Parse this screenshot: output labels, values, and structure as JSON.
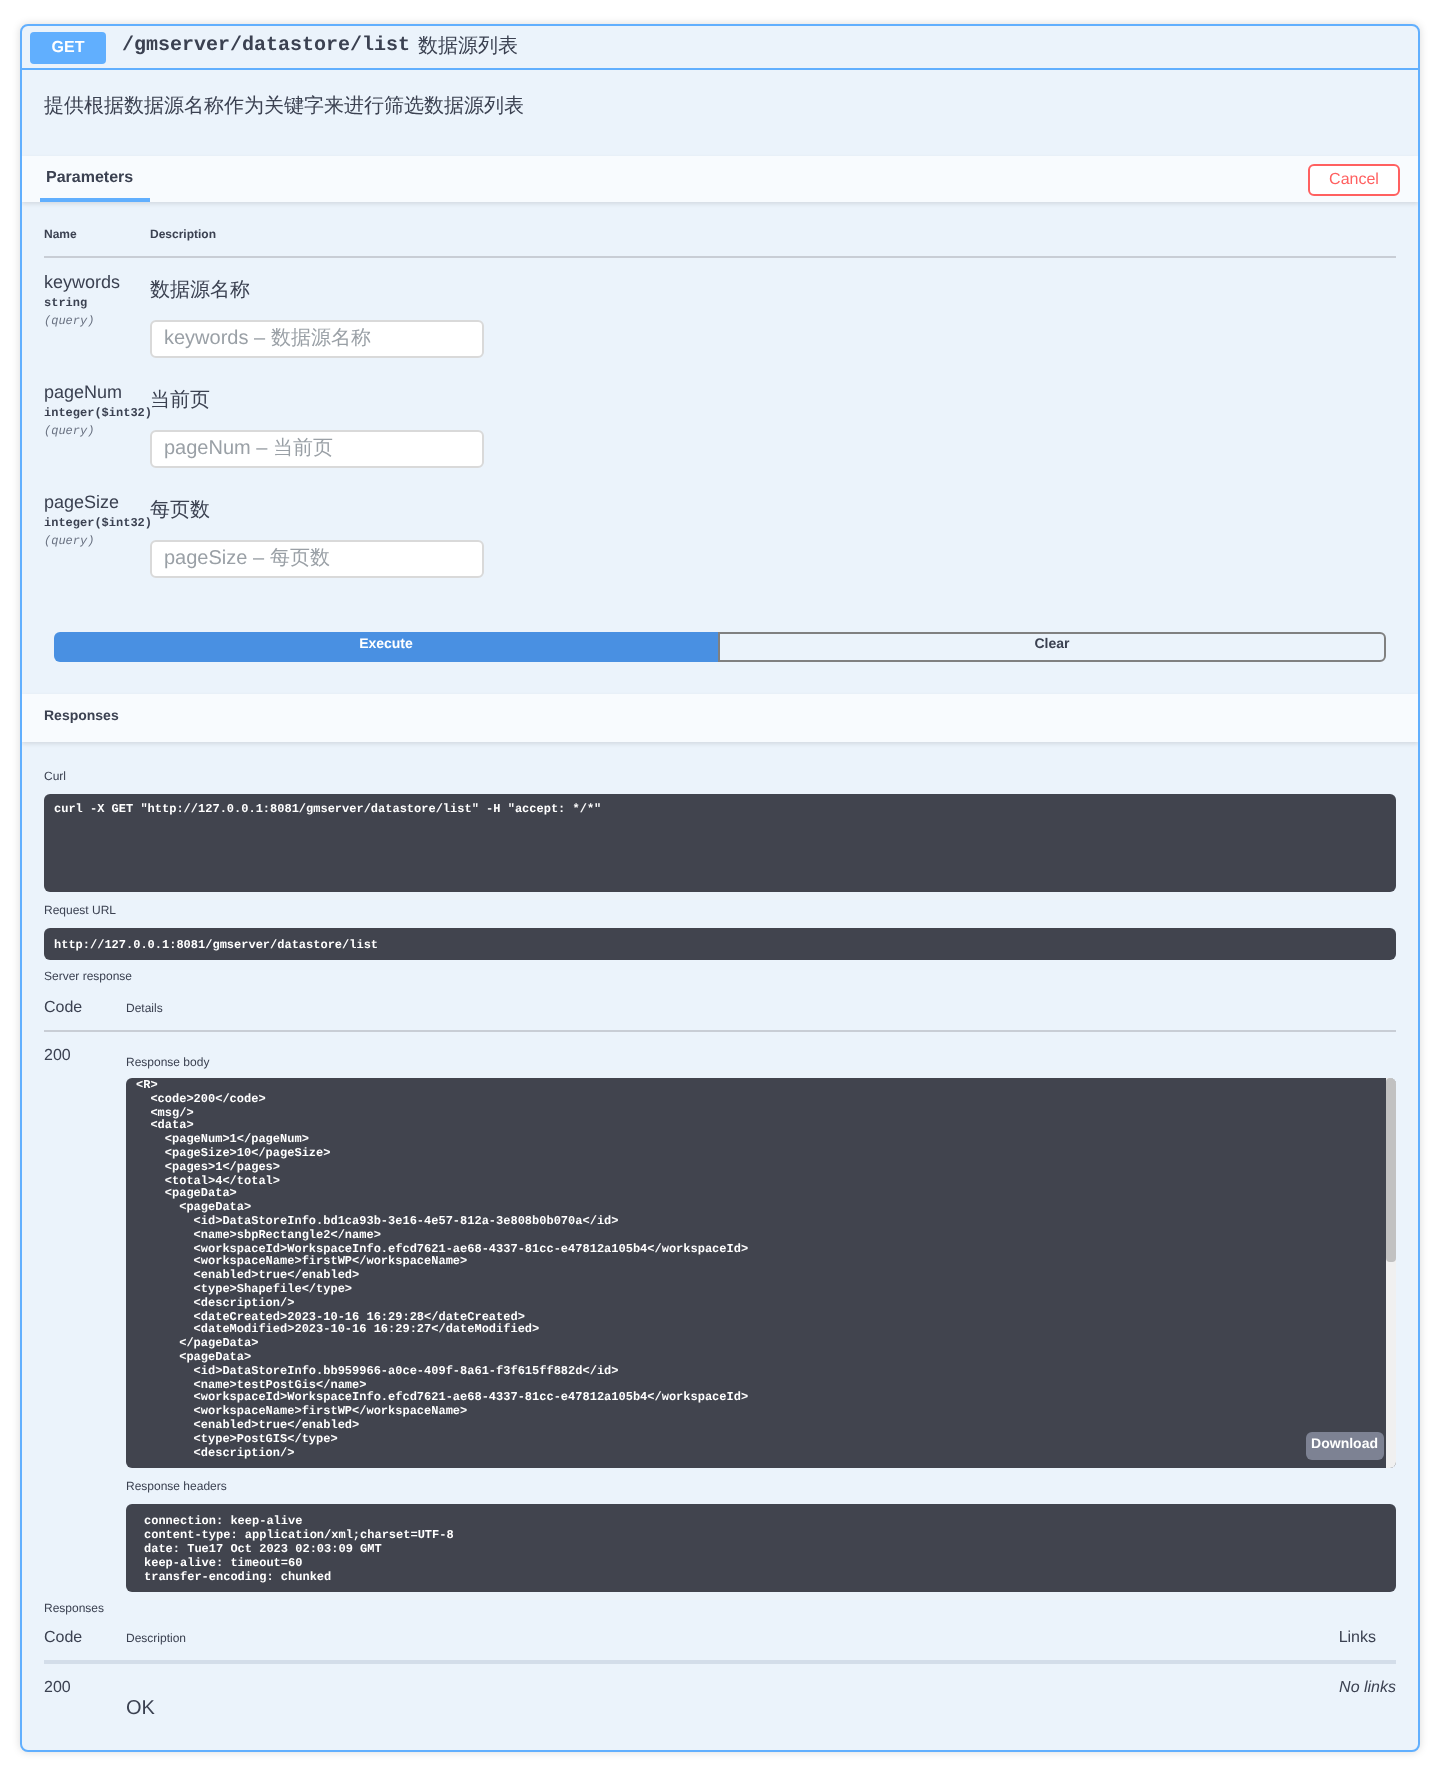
{
  "operation": {
    "method": "GET",
    "path": "/gmserver/datastore/list",
    "summary": "数据源列表",
    "description": "提供根据数据源名称作为关键字来进行筛选数据源列表"
  },
  "parameters_section": {
    "tabs": [
      {
        "label": "Parameters",
        "selected": true
      }
    ],
    "cancel_button": "Cancel",
    "columns": [
      "Name",
      "Description"
    ]
  },
  "parameters": [
    {
      "name": "keywords",
      "type": "string",
      "location": "(query)",
      "description": "数据源名称",
      "placeholder": "keywords – 数据源名称"
    },
    {
      "name": "pageNum",
      "type": "integer($int32)",
      "location": "(query)",
      "description": "当前页",
      "placeholder": "pageNum – 当前页"
    },
    {
      "name": "pageSize",
      "type": "integer($int32)",
      "location": "(query)",
      "description": "每页数",
      "placeholder": "pageSize – 每页数"
    }
  ],
  "execute_button": "Execute",
  "clear_button": "Clear",
  "responses_heading": "Responses",
  "curl": {
    "label": "Curl",
    "command": "curl -X GET \"http://127.0.0.1:8081/gmserver/datastore/list\" -H \"accept: */*\""
  },
  "request_url": {
    "label": "Request URL",
    "value": "http://127.0.0.1:8081/gmserver/datastore/list"
  },
  "server_response": {
    "label": "Server response",
    "columns": [
      "Code",
      "Details"
    ],
    "code": "200",
    "body_label": "Response body",
    "body": "<R>\n  <code>200</code>\n  <msg/>\n  <data>\n    <pageNum>1</pageNum>\n    <pageSize>10</pageSize>\n    <pages>1</pages>\n    <total>4</total>\n    <pageData>\n      <pageData>\n        <id>DataStoreInfo.bd1ca93b-3e16-4e57-812a-3e808b0b070a</id>\n        <name>sbpRectangle2</name>\n        <workspaceId>WorkspaceInfo.efcd7621-ae68-4337-81cc-e47812a105b4</workspaceId>\n        <workspaceName>firstWP</workspaceName>\n        <enabled>true</enabled>\n        <type>Shapefile</type>\n        <description/>\n        <dateCreated>2023-10-16 16:29:28</dateCreated>\n        <dateModified>2023-10-16 16:29:27</dateModified>\n      </pageData>\n      <pageData>\n        <id>DataStoreInfo.bb959966-a0ce-409f-8a61-f3f615ff882d</id>\n        <name>testPostGis</name>\n        <workspaceId>WorkspaceInfo.efcd7621-ae68-4337-81cc-e47812a105b4</workspaceId>\n        <workspaceName>firstWP</workspaceName>\n        <enabled>true</enabled>\n        <type>PostGIS</type>\n        <description/>",
    "download_button": "Download",
    "headers_label": "Response headers",
    "headers": "connection: keep-alive\ncontent-type: application/xml;charset=UTF-8\ndate: Tue17 Oct 2023 02:03:09 GMT\nkeep-alive: timeout=60\ntransfer-encoding: chunked"
  },
  "responses": {
    "label": "Responses",
    "columns": [
      "Code",
      "Description",
      "Links"
    ],
    "rows": [
      {
        "code": "200",
        "description": "OK",
        "links": "No links"
      }
    ]
  }
}
